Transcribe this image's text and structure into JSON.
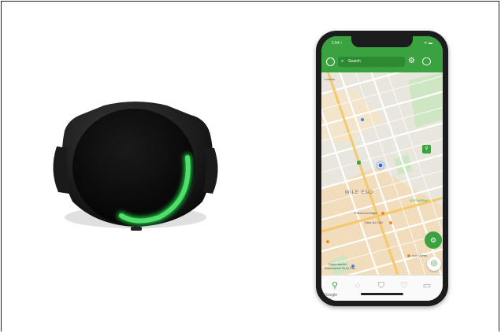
{
  "status_bar": {
    "time": "1:54 ⁴",
    "indicators": "ᯤ ▬"
  },
  "app_bar": {
    "search_placeholder": "Search",
    "icons": [
      "avatar-icon",
      "search-icon",
      "gear-icon",
      "logout-icon"
    ]
  },
  "map": {
    "labels": {
      "top_left": "Lozeau",
      "neighborhood": "MILE END",
      "poi_fairmount": "Fairmount Bagel",
      "poi_dieu": "Dieu du Ciel!",
      "poi_plateau": "LE PLATEAU",
      "poi_super": "Supermarché PA du Parc",
      "poi_supermarket": "Supermarket",
      "poi_aux": "Aux Vivres",
      "attribution": "Google"
    }
  },
  "fab": {
    "icon": "bike-icon"
  },
  "locate": {
    "icon": "locate-icon"
  },
  "tabs": [
    {
      "name": "map-pin-icon",
      "glyph": "⚲"
    },
    {
      "name": "light-icon",
      "glyph": "◌"
    },
    {
      "name": "shield-icon",
      "glyph": "⛉"
    },
    {
      "name": "heart-icon",
      "glyph": "♡"
    },
    {
      "name": "chat-icon",
      "glyph": "▭"
    }
  ],
  "colors": {
    "brand": "#3aa33f",
    "device_light": "#2ecc4b"
  }
}
